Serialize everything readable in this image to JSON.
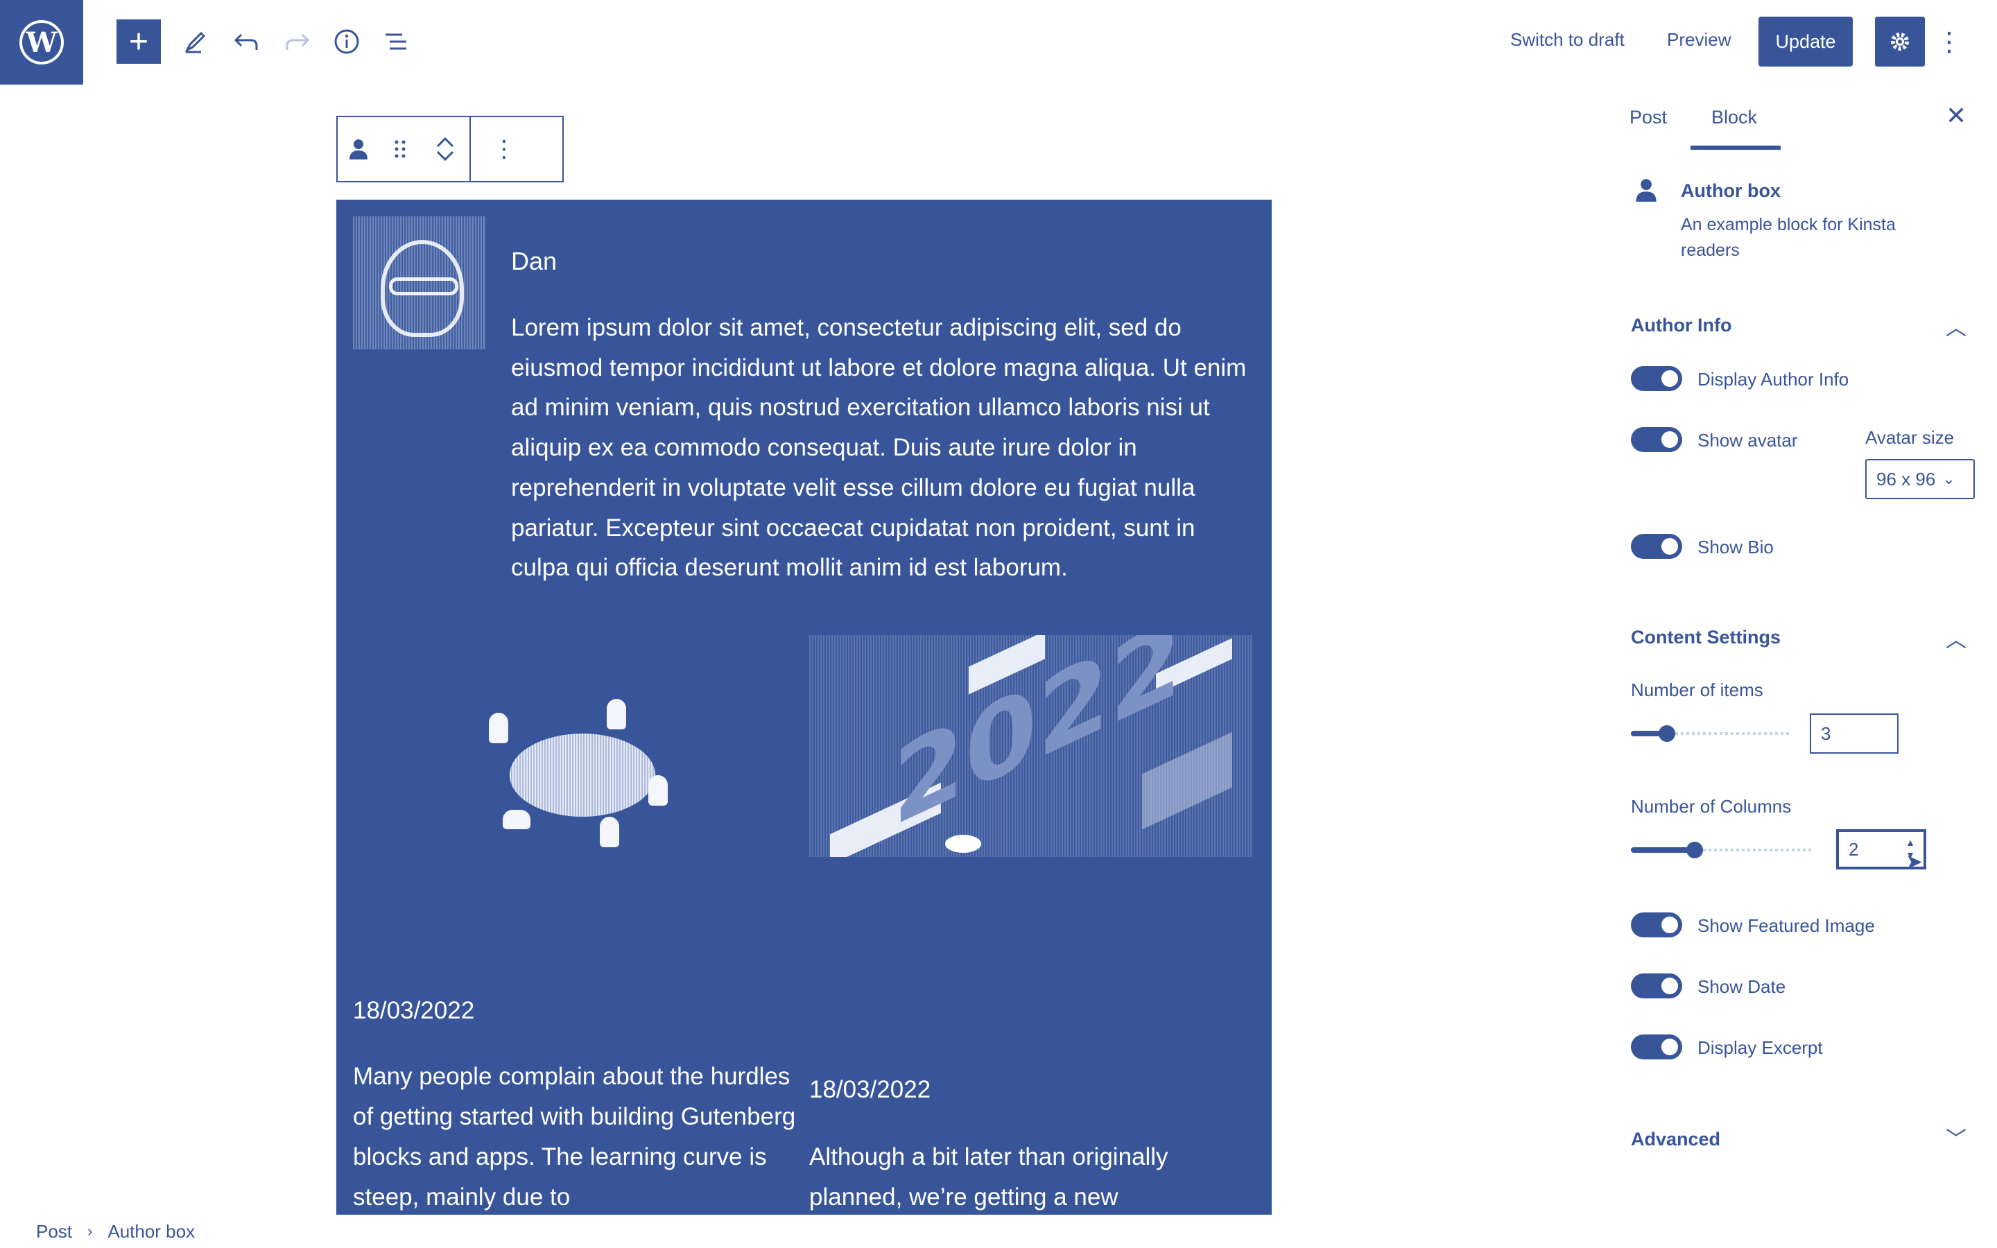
{
  "topbar": {
    "switch_to_draft": "Switch to draft",
    "preview": "Preview",
    "update": "Update",
    "icons": [
      "wordpress-logo",
      "add-block",
      "edit-tools",
      "undo",
      "redo",
      "details-info",
      "list-view",
      "settings-gear",
      "options-kebab"
    ]
  },
  "block": {
    "author_name": "Dan",
    "bio": "Lorem ipsum dolor sit amet, consectetur adipiscing elit, sed do eiusmod tempor incididunt ut labore et dolore magna aliqua. Ut enim ad minim veniam, quis nostrud exercitation ullamco laboris nisi ut aliquip ex ea commodo consequat. Duis aute irure dolor in reprehenderit in voluptate velit esse cillum dolore eu fugiat nulla pariatur. Excepteur sint occaecat cupidatat non proident, sunt in culpa qui officia deserunt mollit anim id est laborum.",
    "posts": [
      {
        "date": "18/03/2022",
        "excerpt": "Many people complain about the hurdles of getting started with building Gutenberg blocks and apps. The learning curve is steep, mainly due to"
      },
      {
        "date": "18/03/2022",
        "excerpt": "Although a bit later than originally planned, we’re getting a new"
      }
    ],
    "illustration_text": "2022"
  },
  "sidebar": {
    "tabs": [
      "Post",
      "Block"
    ],
    "active_tab": "Block",
    "block_card": {
      "title": "Author box",
      "description": "An example block for Kinsta readers"
    },
    "author_info": {
      "title": "Author Info",
      "display_author_info": "Display Author Info",
      "show_avatar": "Show avatar",
      "avatar_size_label": "Avatar size",
      "avatar_size_value": "96 x 96",
      "show_bio": "Show Bio"
    },
    "content_settings": {
      "title": "Content Settings",
      "number_of_items_label": "Number of items",
      "number_of_items_value": "3",
      "number_of_columns_label": "Number of Columns",
      "number_of_columns_value": "2",
      "show_featured_image": "Show Featured Image",
      "show_date": "Show Date",
      "display_excerpt": "Display Excerpt"
    },
    "advanced": {
      "title": "Advanced"
    }
  },
  "breadcrumb": {
    "items": [
      "Post",
      "Author box"
    ]
  },
  "colors": {
    "accent": "#38559a"
  }
}
